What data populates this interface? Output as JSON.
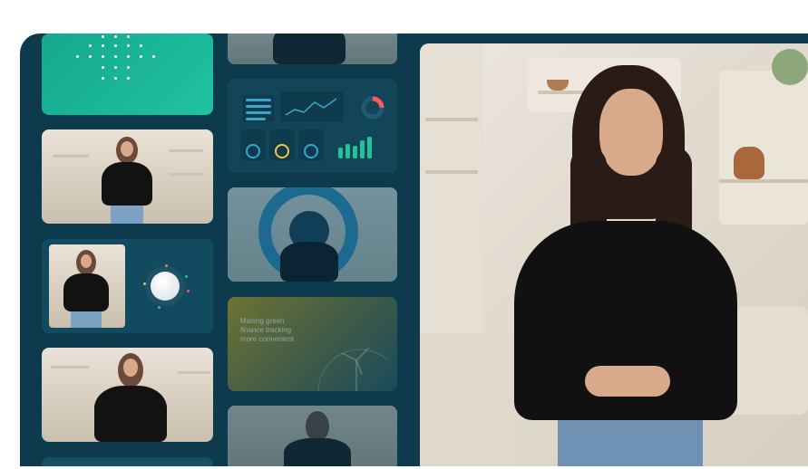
{
  "tiles": {
    "finance_caption_lines": [
      "Making green",
      "finance tracking",
      "more convenient"
    ]
  },
  "colors": {
    "panel_bg": "#0e3a4e",
    "teal_tile": "#17a98d",
    "accent_blue": "#2fa9c9",
    "olive_tile": "#5b6c3c"
  },
  "icons": {
    "dots_pattern": "dot-grid-icon",
    "loading_orb": "loading-orb-icon"
  }
}
